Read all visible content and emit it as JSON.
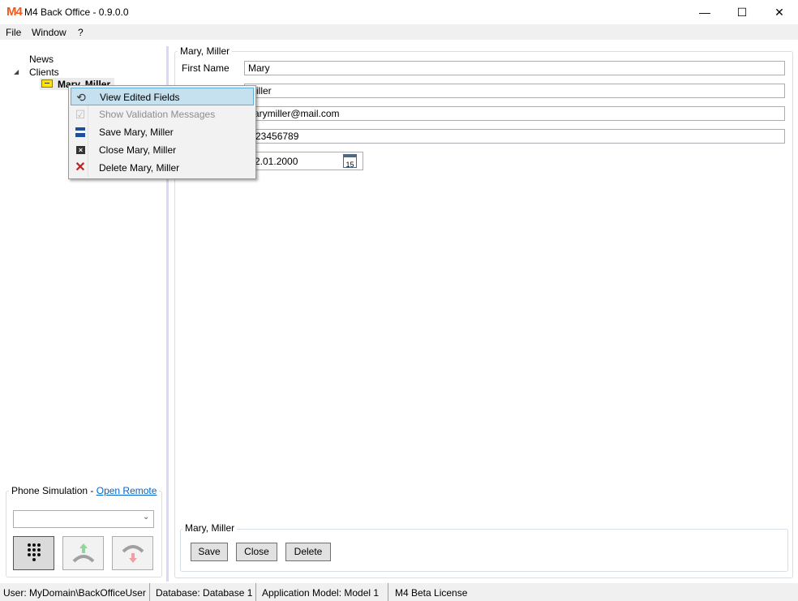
{
  "window": {
    "title": "M4 Back Office - 0.9.0.0",
    "logo": "M4",
    "minimize": "—",
    "maximize": "☐",
    "close": "✕"
  },
  "menu": [
    "File",
    "Window",
    "?"
  ],
  "tree": {
    "news": "News",
    "clients": "Clients",
    "selected": "Mary, Miller"
  },
  "context_menu": [
    {
      "label": "View Edited Fields",
      "icon": "view-edited-icon",
      "highlighted": true,
      "enabled": true
    },
    {
      "label": "Show Validation Messages",
      "icon": "validation-icon",
      "enabled": false
    },
    {
      "label": "Save Mary, Miller",
      "icon": "save-icon",
      "enabled": true
    },
    {
      "label": "Close Mary, Miller",
      "icon": "close-doc-icon",
      "enabled": true
    },
    {
      "label": "Delete Mary, Miller",
      "icon": "delete-icon",
      "enabled": true
    }
  ],
  "form": {
    "group_title": "Mary, Miller",
    "first_name_label": "First Name",
    "first_name": "Mary",
    "last_name": "iller",
    "email": "arymiller@mail.com",
    "phone": "23456789",
    "birthday": "2.01.2000",
    "calendar_day": "15"
  },
  "actions": {
    "group_title": "Mary, Miller",
    "save": "Save",
    "close": "Close",
    "delete": "Delete"
  },
  "phone": {
    "title": "Phone Simulation - ",
    "link": "Open Remote",
    "dropdown_value": ""
  },
  "status": [
    "User: MyDomain\\BackOfficeUser",
    "Database: Database 1",
    "Application Model: Model 1",
    "M4 Beta License"
  ],
  "colors": {
    "accent": "#f25a1f",
    "highlight": "#c5e1ef",
    "link": "#0066cc"
  }
}
